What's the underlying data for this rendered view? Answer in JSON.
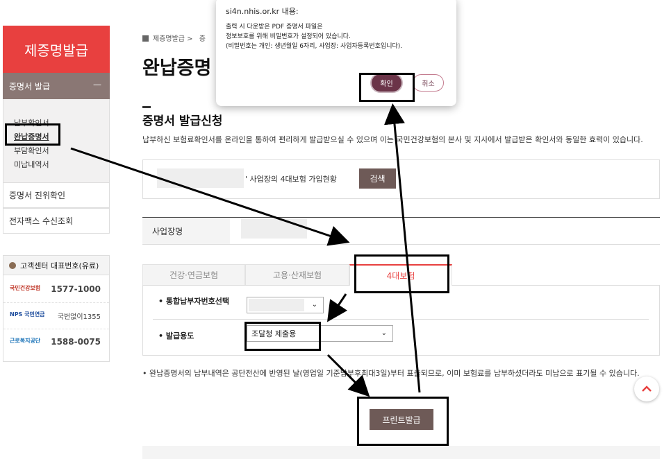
{
  "sidebar": {
    "title": "제증명발급",
    "section": "증명서 발급",
    "section_toggle": "—",
    "sub_items": [
      "납부확인서",
      "완납증명서",
      "부담확인서",
      "미납내역서"
    ],
    "rows": [
      "증명서 진위확인",
      "전자팩스 수신조회"
    ]
  },
  "callcenter": {
    "title": "고객센터 대표번호(유료)",
    "rows": [
      {
        "logo": "국민건강보험",
        "number": "1577-1000"
      },
      {
        "logo": "NPS 국민연금",
        "number": "국번없이1355"
      },
      {
        "logo": "근로복지공단",
        "number": "1588-0075"
      }
    ]
  },
  "breadcrumb": {
    "items": [
      "제증명발급 >",
      "증"
    ]
  },
  "page_title": "완납증명",
  "section_title": "증명서 발급신청",
  "description": "납부하신 보험료확인서를 온라인을 통하여 편리하게 발급받으실 수 있으며 이는 국민건강보험의 본사 및 지사에서 발급받은 확인서와 동일한 효력이 있습니다.",
  "search": {
    "label_tail": "' 사업장의 4대보험 가입현황",
    "button": "검색"
  },
  "table": {
    "header": "사업장명"
  },
  "tabs": [
    {
      "label": "건강·연금보험",
      "active": false
    },
    {
      "label": "고용·산재보험",
      "active": false
    },
    {
      "label": "4대보험",
      "active": true
    }
  ],
  "form": {
    "field1_label": "통합납부자번호선택",
    "field2_label": "발급용도",
    "field2_value": "조달청 제출용"
  },
  "notice": "완납증명서의 납부내역은 공단전산에 반영된 날(영업일 기준납부후최대3일)부터 표출되므로, 이미 보험료를 납부하셨더라도 미납으로 표기될 수 있습니다.",
  "print_button": "프린트발급",
  "dialog": {
    "title": "si4n.nhis.or.kr 내용:",
    "lines": [
      "출력 시 다운받은 PDF 증명서 파일은",
      "정보보호를 위해 비밀번호가 설정되어 있습니다.",
      "(비밀번호는 개인: 생년월일 6자리, 사업장: 사업자등록번호입니다)."
    ],
    "ok": "확인",
    "cancel": "취소"
  },
  "icons": {
    "home": "home-icon",
    "chevron": "chevron-down-icon",
    "up": "arrow-up-icon",
    "phone": "phone-icon"
  },
  "colors": {
    "accent": "#e8403f",
    "brown": "#6e5a57",
    "dialog_ok": "#6b3448"
  }
}
